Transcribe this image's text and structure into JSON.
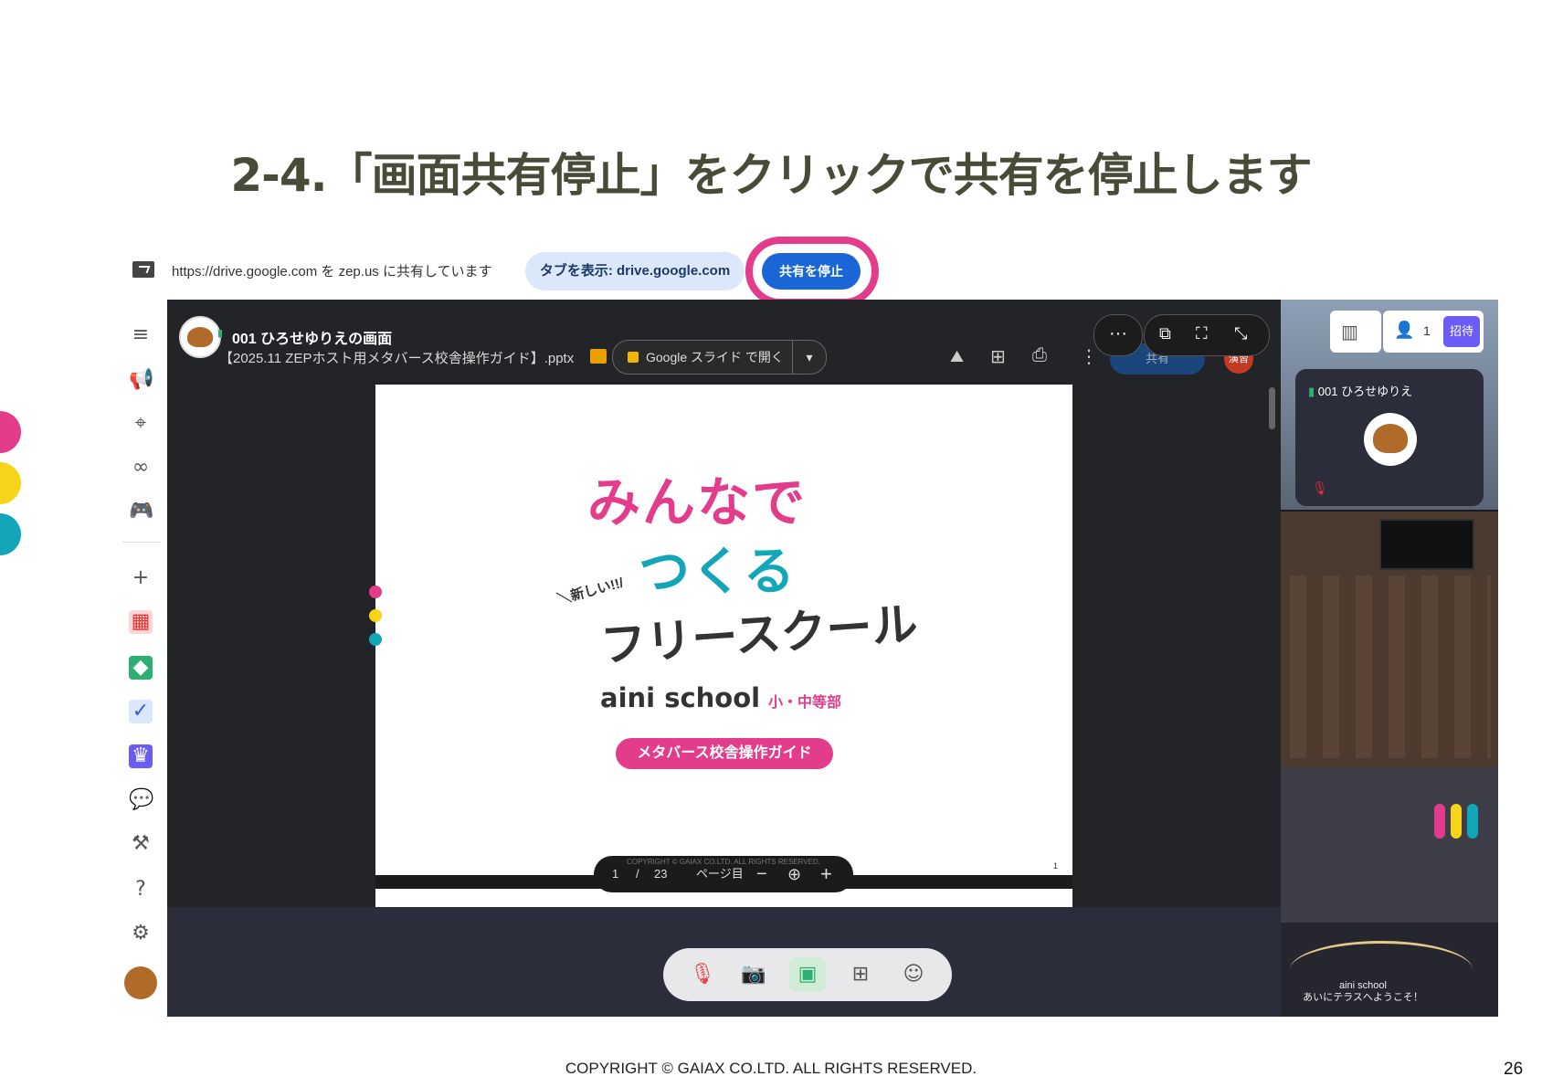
{
  "slide_title": "2-4.「画面共有停止」をクリックで共有を停止します",
  "share_bar": {
    "message": "https://drive.google.com を zep.us に共有しています",
    "show_tab_button": "タブを表示: drive.google.com",
    "stop_share_button": "共有を停止"
  },
  "viewer": {
    "presenter_name": "001 ひろせゆりえの画面",
    "file_name": "【2025.11 ZEPホスト用メタバース校舎操作ガイド】.pptx",
    "open_with": "Google スライド で開く",
    "share_chip": "共有",
    "red_chip": "演習",
    "page_current": "1",
    "page_sep": "/",
    "page_total": "23",
    "page_suffix": "ページ目",
    "slide_page_no": "1",
    "slide_copyright": "COPYRIGHT © GAIAX CO.LTD. ALL RIGHTS RESERVED."
  },
  "slide_content": {
    "tagline": "＼新しい!!/",
    "headline_1": "みんなで",
    "headline_2": "つくる",
    "headline_3": "フリースクール",
    "brand": "aini school",
    "brand_sub": "小・中等部",
    "guide_button": "メタバース校舎操作ガイド"
  },
  "right_panel": {
    "invite_label": "招待",
    "participant_count": "1",
    "video_name": "001 ひろせゆりえ",
    "map_caption_1": "aini school",
    "map_caption_2": "あいにテラスへようこそ！"
  },
  "footer": {
    "copyright": "COPYRIGHT © GAIAX CO.LTD. ALL RIGHTS RESERVED.",
    "page_number": "26"
  },
  "colors": {
    "accent_pink": "#e23c8a",
    "accent_yellow": "#f6d41c",
    "accent_teal": "#13a6b8",
    "share_blue": "#1a66d6",
    "invite_purple": "#6b5cf6"
  },
  "icons": {
    "sidebar": [
      "menu-icon",
      "megaphone-icon",
      "location-pin-icon",
      "link-icon",
      "gamepad-icon",
      "plus-icon",
      "calendar-icon",
      "app-icon",
      "calendar-check-icon",
      "crown-icon",
      "chat-icon",
      "hammer-icon",
      "help-icon",
      "settings-icon",
      "avatar"
    ],
    "controls": [
      "mic-off-icon",
      "camera-off-icon",
      "screen-share-icon",
      "apps-add-icon",
      "emoji-icon"
    ]
  }
}
